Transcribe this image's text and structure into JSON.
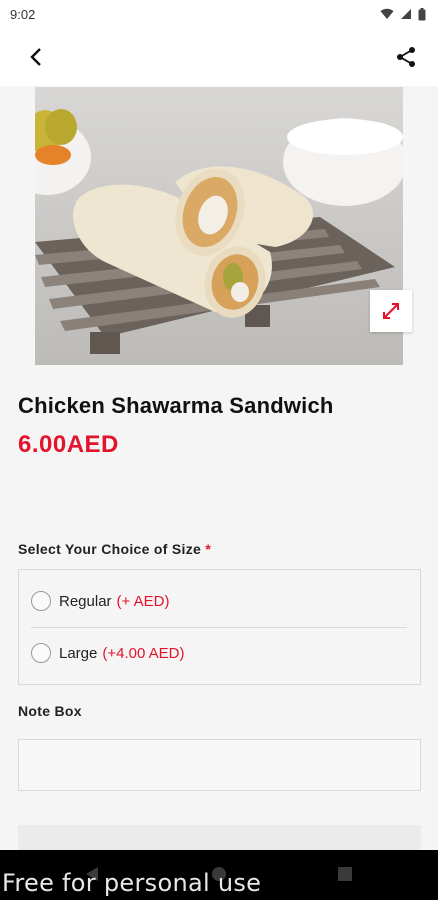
{
  "status_bar": {
    "time": "9:02"
  },
  "app_bar": {
    "back_icon": "chevron-left-icon",
    "share_icon": "share-icon"
  },
  "product": {
    "name": "Chicken Shawarma Sandwich",
    "price": "6.00AED",
    "image_subject": "chicken shawarma wraps on wooden pallet",
    "expand_icon": "expand-icon"
  },
  "size_section": {
    "label": "Select Your Choice of Size",
    "required_mark": "*",
    "options": [
      {
        "name": "Regular",
        "extra": "(+ AED)",
        "selected": false
      },
      {
        "name": "Large",
        "extra": "(+4.00 AED)",
        "selected": false
      }
    ]
  },
  "note_section": {
    "label": "Note Box",
    "value": "",
    "placeholder": ""
  },
  "watermark": "Free for personal use",
  "colors": {
    "accent": "#e4132c",
    "background": "#f5f5f5",
    "border": "#d9d9d9"
  }
}
